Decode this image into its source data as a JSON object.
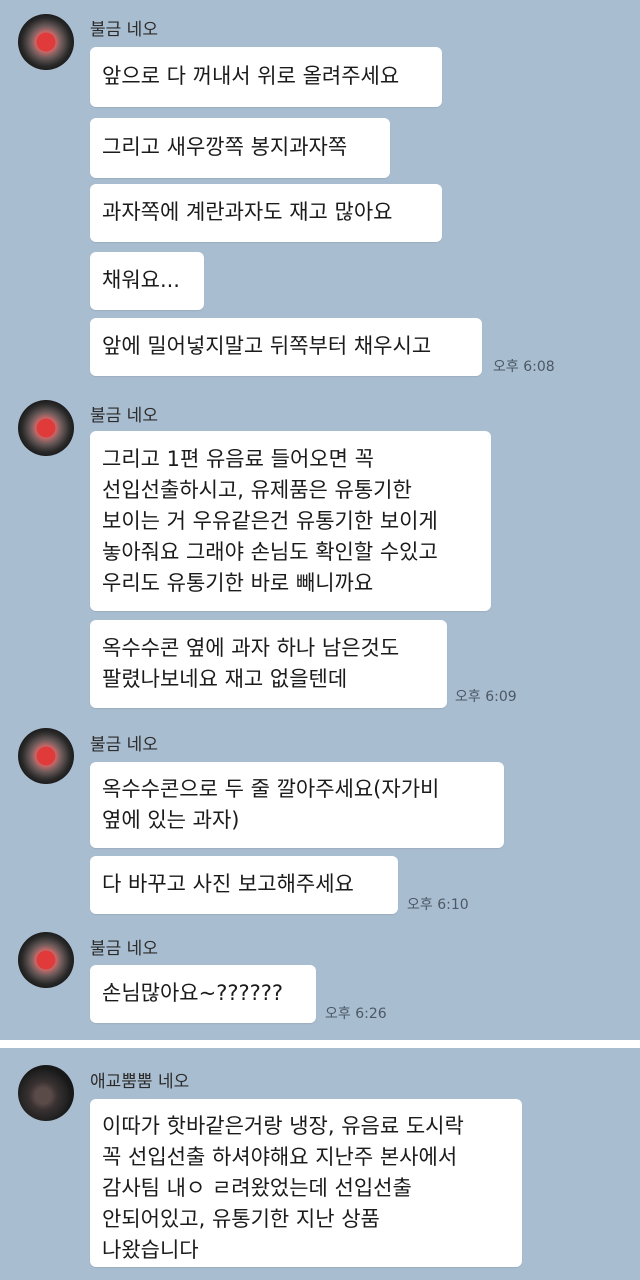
{
  "chats": [
    {
      "sender": "불금 네오",
      "messages": [
        {
          "text": "앞으로 다 꺼내서 위로 올려주세요"
        },
        {
          "text": "그리고 새우깡쪽 봉지과자쪽"
        },
        {
          "text": "과자쪽에 계란과자도 재고 많아요"
        },
        {
          "text": "채워요..."
        },
        {
          "text": "앞에 밀어넣지말고 뒤쪽부터 채우시고"
        }
      ],
      "time": "오후 6:08"
    },
    {
      "sender": "불금 네오",
      "messages": [
        {
          "text": "그리고 1편 유음료 들어오면 꼭\n선입선출하시고, 유제품은 유통기한\n보이는 거 우유같은건 유통기한 보이게\n놓아줘요 그래야 손님도 확인할 수있고\n우리도 유통기한 바로 빼니까요"
        },
        {
          "text": "옥수수콘 옆에 과자 하나 남은것도\n팔렸나보네요 재고 없을텐데"
        }
      ],
      "time": "오후 6:09"
    },
    {
      "sender": "불금 네오",
      "messages": [
        {
          "text": "옥수수콘으로 두 줄 깔아주세요(자가비\n옆에 있는 과자)"
        },
        {
          "text": "다 바꾸고 사진 보고해주세요"
        }
      ],
      "time": "오후 6:10"
    },
    {
      "sender": "불금 네오",
      "messages": [
        {
          "text": "손님많아요~??????"
        }
      ],
      "time": "오후 6:26"
    },
    {
      "sender": "애교뿜뿜 네오",
      "messages": [
        {
          "text": "이따가 핫바같은거랑 냉장, 유음료 도시락\n꼭 선입선출 하셔야해요 지난주 본사에서\n감사팀 내ㅇ ㄹ려왔었는데 선입선출\n안되어있고, 유통기한 지난 상품\n나왔습니다"
        }
      ],
      "time": ""
    }
  ]
}
